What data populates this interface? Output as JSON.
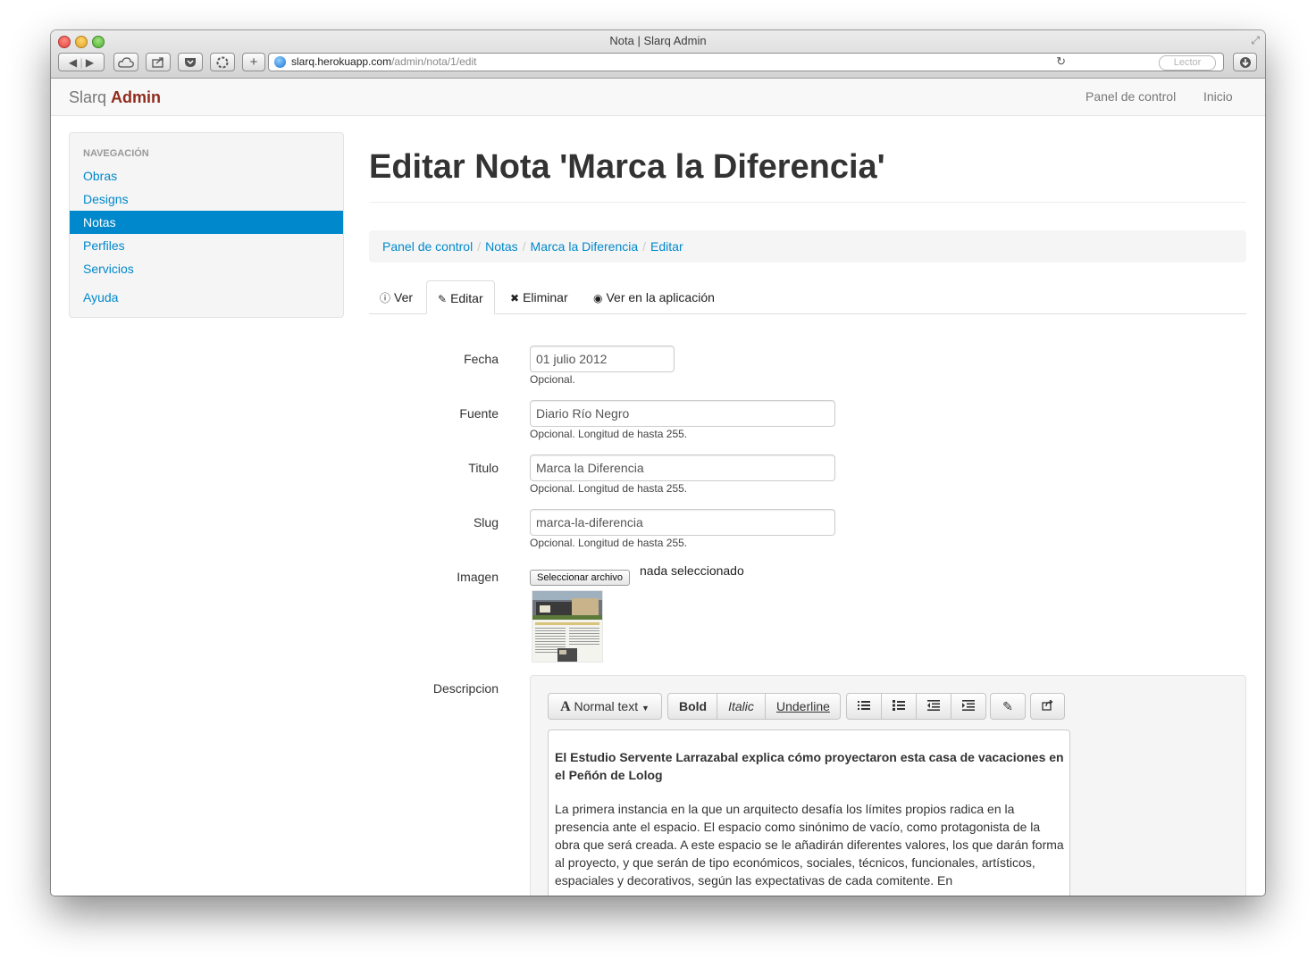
{
  "browser": {
    "title": "Nota | Slarq Admin",
    "url_host": "slarq.herokuapp.com",
    "url_path": "/admin/nota/1/edit",
    "reader_label": "Lector",
    "icons": [
      "back-icon",
      "forward-icon",
      "icloud-icon",
      "share-icon",
      "pocket-icon",
      "extension-icon",
      "new-tab-icon",
      "reload-icon",
      "download-icon",
      "resize-icon"
    ]
  },
  "navbar": {
    "brand": "Slarq",
    "brand_accent": "Admin",
    "links": [
      "Panel de control",
      "Inicio"
    ]
  },
  "sidebar": {
    "header": "NAVEGACIÓN",
    "items": [
      {
        "label": "Obras",
        "active": false
      },
      {
        "label": "Designs",
        "active": false
      },
      {
        "label": "Notas",
        "active": true
      },
      {
        "label": "Perfiles",
        "active": false
      },
      {
        "label": "Servicios",
        "active": false
      },
      {
        "label": "Ayuda",
        "active": false
      }
    ]
  },
  "page": {
    "title": "Editar Nota 'Marca la Diferencia'",
    "breadcrumb": [
      "Panel de control",
      "Notas",
      "Marca la Diferencia",
      "Editar"
    ],
    "tabs": [
      {
        "label": "Ver",
        "icon": "info-icon",
        "active": false
      },
      {
        "label": "Editar",
        "icon": "pencil-icon",
        "active": true
      },
      {
        "label": "Eliminar",
        "icon": "x-icon",
        "active": false
      },
      {
        "label": "Ver en la aplicación",
        "icon": "eye-icon",
        "active": false
      }
    ]
  },
  "form": {
    "fecha": {
      "label": "Fecha",
      "value": "01 julio 2012",
      "help": "Opcional."
    },
    "fuente": {
      "label": "Fuente",
      "value": "Diario Río Negro",
      "help": "Opcional. Longitud de hasta 255."
    },
    "titulo": {
      "label": "Titulo",
      "value": "Marca la Diferencia",
      "help": "Opcional. Longitud de hasta 255."
    },
    "slug": {
      "label": "Slug",
      "value": "marca-la-diferencia",
      "help": "Opcional. Longitud de hasta 255."
    },
    "imagen": {
      "label": "Imagen",
      "button": "Seleccionar archivo",
      "status": "nada seleccionado"
    },
    "descripcion": {
      "label": "Descripcion",
      "toolbar": {
        "style_label": "Normal text",
        "bold": "Bold",
        "italic": "Italic",
        "underline": "Underline"
      },
      "lead": "El Estudio Servente Larrazabal explica cómo proyectaron esta casa de vacaciones en el Peñón de Lolog",
      "body": "La primera instancia en la que un arquitecto desafía los límites propios radica en la presencia ante el espacio. El espacio como sinónimo de vacío, como protagonista de la obra que será creada. A este espacio se le añadirán diferentes valores, los que darán forma al proyecto, y que serán de tipo económicos, sociales, técnicos, funcionales, artísticos, espaciales y decorativos, según las expectativas de cada comitente. En"
    }
  }
}
